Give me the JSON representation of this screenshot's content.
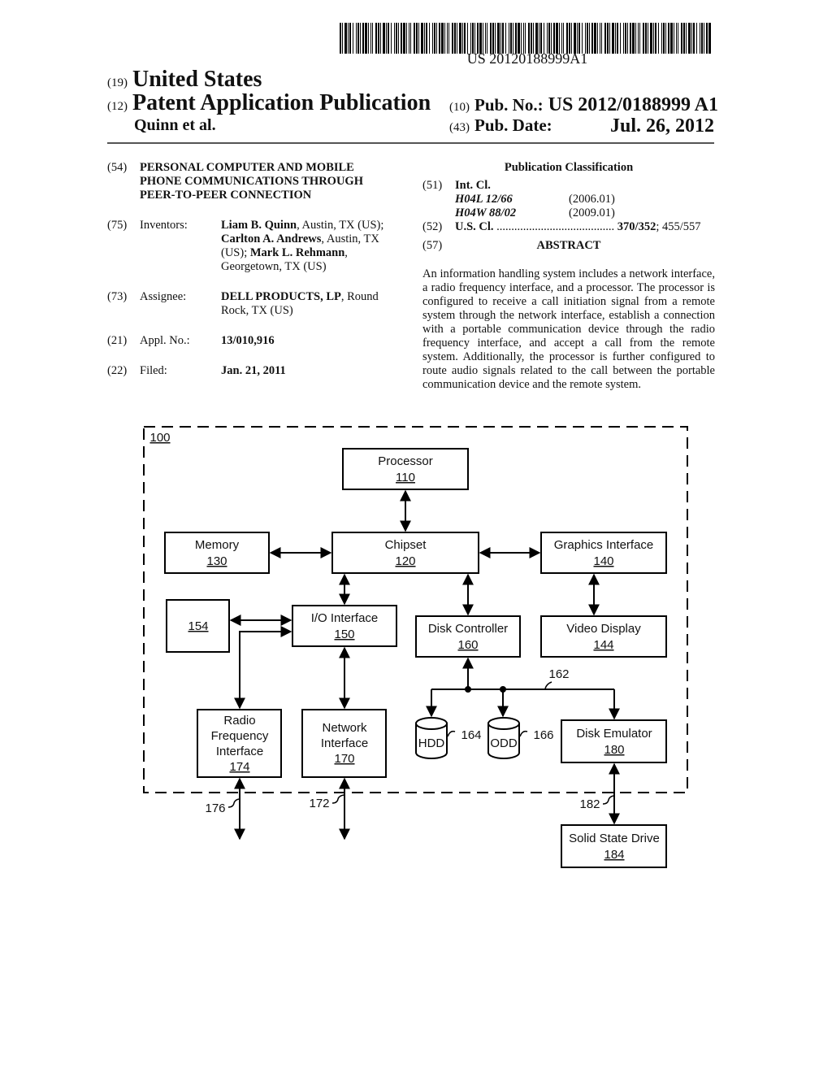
{
  "header": {
    "barcode_text": "US 20120188999A1",
    "country_num": "(19)",
    "country": "United States",
    "doc_type_num": "(12)",
    "doc_type": "Patent Application Publication",
    "authors": "Quinn et al.",
    "pub_no_num": "(10)",
    "pub_no_label": "Pub. No.:",
    "pub_no": "US 2012/0188999 A1",
    "pub_date_num": "(43)",
    "pub_date_label": "Pub. Date:",
    "pub_date": "Jul. 26, 2012"
  },
  "biblio": {
    "title_num": "(54)",
    "title": "PERSONAL COMPUTER AND MOBILE PHONE COMMUNICATIONS THROUGH PEER-TO-PEER CONNECTION",
    "inventors_num": "(75)",
    "inventors_label": "Inventors:",
    "inventors": [
      {
        "name": "Liam B. Quinn",
        "location": ", Austin, TX (US); "
      },
      {
        "name": "Carlton A. Andrews",
        "location": ", Austin, TX (US); "
      },
      {
        "name": "Mark L. Rehmann",
        "location": ", Georgetown, TX (US)"
      }
    ],
    "assignee_num": "(73)",
    "assignee_label": "Assignee:",
    "assignee_name": "DELL PRODUCTS, LP",
    "assignee_location": ", Round Rock, TX (US)",
    "appl_num": "(21)",
    "appl_label": "Appl. No.:",
    "appl_no": "13/010,916",
    "filed_num": "(22)",
    "filed_label": "Filed:",
    "filed": "Jan. 21, 2011"
  },
  "classification": {
    "title": "Publication Classification",
    "int_cl_num": "(51)",
    "int_cl_label": "Int. Cl.",
    "int_cl": [
      {
        "code": "H04L 12/66",
        "version": "(2006.01)"
      },
      {
        "code": "H04W 88/02",
        "version": "(2009.01)"
      }
    ],
    "us_cl_num": "(52)",
    "us_cl_label": "U.S. Cl.",
    "us_cl_dots": " ........................................ ",
    "us_cl_primary": "370/352",
    "us_cl_secondary": "; 455/557",
    "abstract_num": "(57)",
    "abstract_label": "ABSTRACT",
    "abstract": "An information handling system includes a network interface, a radio frequency interface, and a processor. The processor is configured to receive a call initiation signal from a remote system through the network interface, establish a connection with a portable communication device through the radio frequency interface, and accept a call from the remote system. Additionally, the processor is further configured to route audio signals related to the call between the portable communication device and the remote system."
  },
  "figure": {
    "system_ref": "100",
    "blocks": {
      "processor": {
        "label": "Processor",
        "ref": "110"
      },
      "chipset": {
        "label": "Chipset",
        "ref": "120"
      },
      "memory": {
        "label": "Memory",
        "ref": "130"
      },
      "graphics": {
        "label": "Graphics Interface",
        "ref": "140"
      },
      "video": {
        "label": "Video Display",
        "ref": "144"
      },
      "io": {
        "label": "I/O Interface",
        "ref": "150"
      },
      "block154": {
        "label": "",
        "ref": "154"
      },
      "disk_ctrl": {
        "label": "Disk Controller",
        "ref": "160"
      },
      "rf_l1": "Radio",
      "rf_l2": "Frequency",
      "rf_l3": "Interface",
      "rf_ref": "174",
      "net_l1": "Network",
      "net_l2": "Interface",
      "net_ref": "170",
      "disk_emu": {
        "label": "Disk Emulator",
        "ref": "180"
      },
      "ssd": {
        "label": "Solid State Drive",
        "ref": "184"
      },
      "hdd": {
        "label": "HDD",
        "ref": "164"
      },
      "odd": {
        "label": "ODD",
        "ref": "166"
      }
    },
    "bus_ref": "162",
    "rf_link_ref": "176",
    "net_link_ref": "172",
    "ssd_link_ref": "182"
  }
}
